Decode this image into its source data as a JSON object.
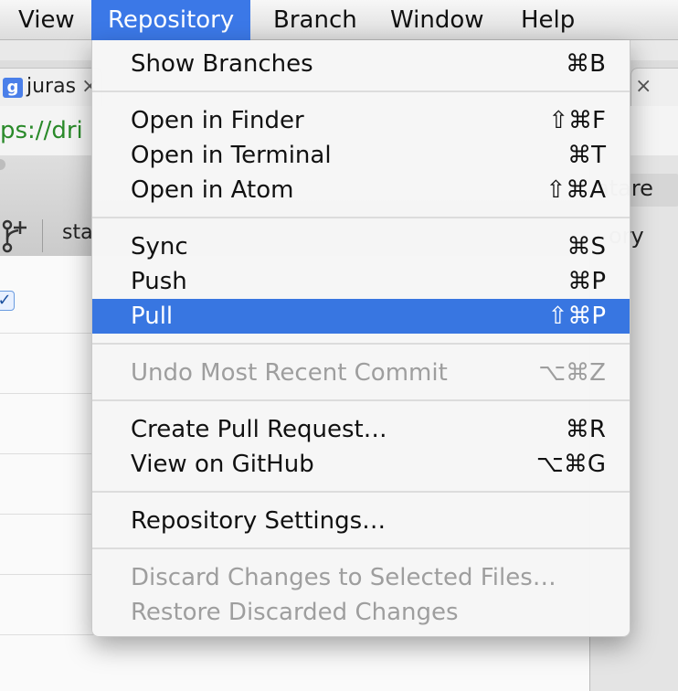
{
  "menubar": {
    "items": [
      {
        "label": "View"
      },
      {
        "label": "Repository"
      },
      {
        "label": "Branch"
      },
      {
        "label": "Window"
      },
      {
        "label": "Help"
      }
    ]
  },
  "browser": {
    "tab_left_label": "juras",
    "tab_close": "×",
    "tab_right_close": "×",
    "url_prefix": "ps://dri"
  },
  "app": {
    "toolbar_label": "sta",
    "right_text_1": "atare",
    "right_text_2": "ory",
    "checkbox_glyph": "✓"
  },
  "menu": {
    "items": [
      {
        "label": "Show Branches",
        "shortcut": "⌘B"
      },
      {
        "label": "Open in Finder",
        "shortcut": "⇧⌘F"
      },
      {
        "label": "Open in Terminal",
        "shortcut": "⌘T"
      },
      {
        "label": "Open in Atom",
        "shortcut": "⇧⌘A"
      },
      {
        "label": "Sync",
        "shortcut": "⌘S"
      },
      {
        "label": "Push",
        "shortcut": "⌘P"
      },
      {
        "label": "Pull",
        "shortcut": "⇧⌘P"
      },
      {
        "label": "Undo Most Recent Commit",
        "shortcut": "⌥⌘Z"
      },
      {
        "label": "Create Pull Request…",
        "shortcut": "⌘R"
      },
      {
        "label": "View on GitHub",
        "shortcut": "⌥⌘G"
      },
      {
        "label": "Repository Settings…",
        "shortcut": ""
      },
      {
        "label": "Discard Changes to Selected Files…",
        "shortcut": ""
      },
      {
        "label": "Restore Discarded Changes",
        "shortcut": ""
      }
    ]
  },
  "colors": {
    "highlight": "#3876e1",
    "menubar_active": "#3b78e7",
    "disabled_text": "#9e9e9e"
  }
}
